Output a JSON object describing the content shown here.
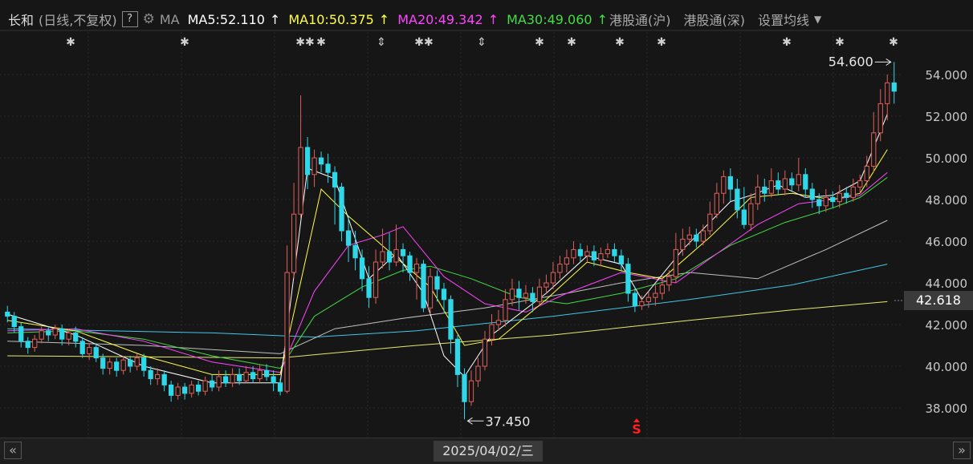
{
  "header": {
    "stock_name": "长和",
    "period": "(日线,不复权)",
    "help": "?",
    "ma_label": "MA",
    "ma5": "MA5:52.110",
    "ma10": "MA10:50.375",
    "ma20": "MA20:49.342",
    "ma30": "MA30:49.060",
    "arrow": "↑",
    "hk_connect_sh": "港股通(沪)",
    "hk_connect_sz": "港股通(深)",
    "settings": "设置均线"
  },
  "colors": {
    "up": "#e0605a",
    "down": "#2ed8e8",
    "ma5": "#ffffff",
    "ma10": "#ffff44",
    "ma20": "#ff44ff",
    "ma30": "#44dd44",
    "ma60": "#c0c0c0",
    "ma120": "#40c8e8",
    "ma250": "#e8e870"
  },
  "current_price_label": "42.618",
  "high_label": "54.600",
  "low_label": "37.450",
  "date_label": "2025/04/02/三",
  "nav": {
    "left": "«",
    "right": "»"
  },
  "event_markers": [
    "✱",
    "✱",
    "✱✱",
    "✱",
    "⇕",
    "✱✱",
    "⇕",
    "✱",
    "✱",
    "✱",
    "✱",
    "✱",
    "✱",
    "✱"
  ],
  "signal_marker": "S",
  "chart_data": {
    "type": "candlestick",
    "title": "长和",
    "y_ticks": [
      "54.000",
      "52.000",
      "50.000",
      "48.000",
      "46.000",
      "44.000",
      "42.000",
      "40.000",
      "38.000"
    ],
    "ylim": [
      37,
      55
    ],
    "max_price": 54.6,
    "min_price": 37.45,
    "current_price": 42.618,
    "candles": [
      [
        42.6,
        42.4,
        42.9,
        42.1
      ],
      [
        42.4,
        41.9,
        42.6,
        41.6
      ],
      [
        41.9,
        41.2,
        42.1,
        40.9
      ],
      [
        41.2,
        40.9,
        41.4,
        40.6
      ],
      [
        40.9,
        41.3,
        41.5,
        40.7
      ],
      [
        41.3,
        41.7,
        41.9,
        41.1
      ],
      [
        41.7,
        41.5,
        41.9,
        41.2
      ],
      [
        41.5,
        41.8,
        42.0,
        41.3
      ],
      [
        41.8,
        41.3,
        42.0,
        41.0
      ],
      [
        41.3,
        41.6,
        41.8,
        41.0
      ],
      [
        41.6,
        41.2,
        41.9,
        40.9
      ],
      [
        41.2,
        40.6,
        41.4,
        40.4
      ],
      [
        40.6,
        40.9,
        41.1,
        40.3
      ],
      [
        40.9,
        40.4,
        41.1,
        40.2
      ],
      [
        40.4,
        39.9,
        40.6,
        39.6
      ],
      [
        39.9,
        40.2,
        40.4,
        39.6
      ],
      [
        40.2,
        39.8,
        40.4,
        39.5
      ],
      [
        39.8,
        40.3,
        40.5,
        39.6
      ],
      [
        40.3,
        40.0,
        40.5,
        39.7
      ],
      [
        40.0,
        40.4,
        40.6,
        39.8
      ],
      [
        40.4,
        39.8,
        40.6,
        39.5
      ],
      [
        39.8,
        39.4,
        40.0,
        39.1
      ],
      [
        39.4,
        39.6,
        39.9,
        39.1
      ],
      [
        39.6,
        39.1,
        39.8,
        38.8
      ],
      [
        39.1,
        38.6,
        39.3,
        38.3
      ],
      [
        38.6,
        39.0,
        39.2,
        38.4
      ],
      [
        39.0,
        38.7,
        39.2,
        38.4
      ],
      [
        38.7,
        39.1,
        39.3,
        38.5
      ],
      [
        39.1,
        38.8,
        39.3,
        38.6
      ],
      [
        38.8,
        39.3,
        39.5,
        38.6
      ],
      [
        39.3,
        39.0,
        39.6,
        38.8
      ],
      [
        39.0,
        39.5,
        39.8,
        38.8
      ],
      [
        39.5,
        39.2,
        39.8,
        39.0
      ],
      [
        39.2,
        39.6,
        39.9,
        39.0
      ],
      [
        39.6,
        39.3,
        39.9,
        39.1
      ],
      [
        39.3,
        39.7,
        40.0,
        39.2
      ],
      [
        39.7,
        39.4,
        40.0,
        39.2
      ],
      [
        39.4,
        39.8,
        40.1,
        39.2
      ],
      [
        39.8,
        39.5,
        40.1,
        39.3
      ],
      [
        39.5,
        39.2,
        39.8,
        38.8
      ],
      [
        39.2,
        38.8,
        39.4,
        38.6
      ],
      [
        38.8,
        44.5,
        45.8,
        38.7
      ],
      [
        44.5,
        47.3,
        48.8,
        44.2
      ],
      [
        47.3,
        50.5,
        53.0,
        47.1
      ],
      [
        50.5,
        49.2,
        51.0,
        48.5
      ],
      [
        49.2,
        50.0,
        50.4,
        48.6
      ],
      [
        50.0,
        49.7,
        50.3,
        49.3
      ],
      [
        49.7,
        49.3,
        50.2,
        48.8
      ],
      [
        49.3,
        48.6,
        49.6,
        46.8
      ],
      [
        48.6,
        46.5,
        48.8,
        46.0
      ],
      [
        46.5,
        45.8,
        47.2,
        45.0
      ],
      [
        45.8,
        45.2,
        46.5,
        44.6
      ],
      [
        45.2,
        44.2,
        45.6,
        43.6
      ],
      [
        44.2,
        43.3,
        44.8,
        42.8
      ],
      [
        43.3,
        45.0,
        45.6,
        43.0
      ],
      [
        45.0,
        45.5,
        46.6,
        44.7
      ],
      [
        45.5,
        45.0,
        46.4,
        44.6
      ],
      [
        45.0,
        45.6,
        46.8,
        44.8
      ],
      [
        45.6,
        45.3,
        45.9,
        44.5
      ],
      [
        45.3,
        44.5,
        45.5,
        44.1
      ],
      [
        44.5,
        44.9,
        45.2,
        43.2
      ],
      [
        44.9,
        42.8,
        45.1,
        42.6
      ],
      [
        42.8,
        44.3,
        44.7,
        42.5
      ],
      [
        44.3,
        43.7,
        44.6,
        43.1
      ],
      [
        43.7,
        43.2,
        44.0,
        42.6
      ],
      [
        43.2,
        41.3,
        43.4,
        40.6
      ],
      [
        41.3,
        39.6,
        41.5,
        39.0
      ],
      [
        39.6,
        38.3,
        39.9,
        37.45
      ],
      [
        38.3,
        39.3,
        39.8,
        38.1
      ],
      [
        39.3,
        40.0,
        40.4,
        39.0
      ],
      [
        40.0,
        41.3,
        41.7,
        39.8
      ],
      [
        41.3,
        42.0,
        42.5,
        41.0
      ],
      [
        42.0,
        42.2,
        42.7,
        41.7
      ],
      [
        42.2,
        43.2,
        43.7,
        41.9
      ],
      [
        43.2,
        43.7,
        44.2,
        42.9
      ],
      [
        43.7,
        43.3,
        44.1,
        42.7
      ],
      [
        43.3,
        43.5,
        43.9,
        43.0
      ],
      [
        43.5,
        43.1,
        43.8,
        42.6
      ],
      [
        43.1,
        43.8,
        44.2,
        42.9
      ],
      [
        43.8,
        44.0,
        44.4,
        43.5
      ],
      [
        44.0,
        44.5,
        45.0,
        43.7
      ],
      [
        44.5,
        44.9,
        45.3,
        44.2
      ],
      [
        44.9,
        45.2,
        45.6,
        44.5
      ],
      [
        45.2,
        45.6,
        46.0,
        44.9
      ],
      [
        45.6,
        45.3,
        45.9,
        45.0
      ],
      [
        45.3,
        45.5,
        45.8,
        45.0
      ],
      [
        45.5,
        45.1,
        45.8,
        44.8
      ],
      [
        45.1,
        45.4,
        45.7,
        44.8
      ],
      [
        45.4,
        45.6,
        45.9,
        45.2
      ],
      [
        45.6,
        45.3,
        45.9,
        45.0
      ],
      [
        45.3,
        44.9,
        45.6,
        44.6
      ],
      [
        44.9,
        43.5,
        45.2,
        43.1
      ],
      [
        43.5,
        42.9,
        43.8,
        42.6
      ],
      [
        42.9,
        43.1,
        43.4,
        42.7
      ],
      [
        43.1,
        43.3,
        43.6,
        42.8
      ],
      [
        43.3,
        43.5,
        43.9,
        42.9
      ],
      [
        43.5,
        43.9,
        44.3,
        43.2
      ],
      [
        43.9,
        44.3,
        44.6,
        43.6
      ],
      [
        44.3,
        45.6,
        46.4,
        44.0
      ],
      [
        45.6,
        46.1,
        46.6,
        45.3
      ],
      [
        46.1,
        46.3,
        46.7,
        45.8
      ],
      [
        46.3,
        46.0,
        46.6,
        45.7
      ],
      [
        46.0,
        46.5,
        46.8,
        45.8
      ],
      [
        46.5,
        47.3,
        47.9,
        46.3
      ],
      [
        47.3,
        48.3,
        48.8,
        47.1
      ],
      [
        48.3,
        49.1,
        49.4,
        47.8
      ],
      [
        49.1,
        48.5,
        49.5,
        47.9
      ],
      [
        48.5,
        47.5,
        49.0,
        47.1
      ],
      [
        47.5,
        46.8,
        48.6,
        46.6
      ],
      [
        46.8,
        47.8,
        48.3,
        46.5
      ],
      [
        47.8,
        48.6,
        49.2,
        47.5
      ],
      [
        48.6,
        48.3,
        49.0,
        47.9
      ],
      [
        48.3,
        48.9,
        49.5,
        48.1
      ],
      [
        48.9,
        48.5,
        49.3,
        48.2
      ],
      [
        48.5,
        49.0,
        49.4,
        48.2
      ],
      [
        49.0,
        48.7,
        49.3,
        48.4
      ],
      [
        48.7,
        49.2,
        50.0,
        48.4
      ],
      [
        49.2,
        48.5,
        49.5,
        48.1
      ],
      [
        48.5,
        48.0,
        48.8,
        47.6
      ],
      [
        48.0,
        47.7,
        48.3,
        47.3
      ],
      [
        47.7,
        48.1,
        48.5,
        47.4
      ],
      [
        48.1,
        47.9,
        48.4,
        47.6
      ],
      [
        47.9,
        48.3,
        48.7,
        47.6
      ],
      [
        48.3,
        48.1,
        48.6,
        47.8
      ],
      [
        48.1,
        48.6,
        49.0,
        47.9
      ],
      [
        48.6,
        48.9,
        49.2,
        48.3
      ],
      [
        48.9,
        49.6,
        50.1,
        48.6
      ],
      [
        49.6,
        51.2,
        52.2,
        49.3
      ],
      [
        51.2,
        52.6,
        53.3,
        50.8
      ],
      [
        52.6,
        53.6,
        54.0,
        51.8
      ],
      [
        53.6,
        53.2,
        54.6,
        52.6
      ]
    ],
    "ma_lines": {
      "ma5": [
        [
          0,
          42.5
        ],
        [
          10,
          41.5
        ],
        [
          20,
          40.0
        ],
        [
          30,
          39.2
        ],
        [
          40,
          39.2
        ],
        [
          44,
          49.5
        ],
        [
          48,
          49.0
        ],
        [
          53,
          44.2
        ],
        [
          57,
          45.4
        ],
        [
          61,
          43.5
        ],
        [
          64,
          40.5
        ],
        [
          67,
          39.5
        ],
        [
          71,
          41.5
        ],
        [
          79,
          43.5
        ],
        [
          85,
          45.3
        ],
        [
          90,
          44.9
        ],
        [
          93,
          43.2
        ],
        [
          99,
          45.6
        ],
        [
          106,
          47.9
        ],
        [
          109,
          48.2
        ],
        [
          113,
          48.7
        ],
        [
          117,
          48.1
        ],
        [
          121,
          48.2
        ],
        [
          125,
          48.9
        ],
        [
          129,
          52.1
        ]
      ],
      "ma10": [
        [
          0,
          42.2
        ],
        [
          10,
          41.7
        ],
        [
          20,
          40.5
        ],
        [
          30,
          39.6
        ],
        [
          40,
          39.6
        ],
        [
          46,
          48.5
        ],
        [
          50,
          47.2
        ],
        [
          56,
          45.5
        ],
        [
          62,
          43.8
        ],
        [
          67,
          41.0
        ],
        [
          72,
          41.3
        ],
        [
          79,
          43.2
        ],
        [
          85,
          45.0
        ],
        [
          91,
          44.5
        ],
        [
          96,
          44.2
        ],
        [
          103,
          46.2
        ],
        [
          109,
          48.1
        ],
        [
          115,
          48.3
        ],
        [
          121,
          48.0
        ],
        [
          125,
          48.3
        ],
        [
          129,
          50.4
        ]
      ],
      "ma20": [
        [
          0,
          41.7
        ],
        [
          10,
          41.8
        ],
        [
          20,
          41.2
        ],
        [
          30,
          40.2
        ],
        [
          40,
          39.7
        ],
        [
          45,
          43.6
        ],
        [
          50,
          45.8
        ],
        [
          55,
          46.3
        ],
        [
          58,
          46.7
        ],
        [
          64,
          44.3
        ],
        [
          70,
          43.0
        ],
        [
          76,
          42.6
        ],
        [
          82,
          43.5
        ],
        [
          90,
          44.5
        ],
        [
          98,
          44.0
        ],
        [
          104,
          45.4
        ],
        [
          110,
          46.8
        ],
        [
          116,
          47.8
        ],
        [
          121,
          48.0
        ],
        [
          125,
          48.2
        ],
        [
          129,
          49.3
        ]
      ],
      "ma30": [
        [
          0,
          41.6
        ],
        [
          10,
          41.7
        ],
        [
          20,
          41.3
        ],
        [
          30,
          40.5
        ],
        [
          40,
          39.9
        ],
        [
          45,
          42.4
        ],
        [
          52,
          43.8
        ],
        [
          58,
          44.6
        ],
        [
          62,
          44.8
        ],
        [
          68,
          44.2
        ],
        [
          75,
          43.3
        ],
        [
          82,
          43.0
        ],
        [
          90,
          43.5
        ],
        [
          98,
          44.2
        ],
        [
          106,
          45.8
        ],
        [
          114,
          46.9
        ],
        [
          121,
          47.6
        ],
        [
          125,
          48.1
        ],
        [
          129,
          49.06
        ]
      ],
      "ma60": [
        [
          0,
          41.2
        ],
        [
          20,
          41.0
        ],
        [
          40,
          40.6
        ],
        [
          48,
          41.8
        ],
        [
          58,
          42.3
        ],
        [
          70,
          42.8
        ],
        [
          82,
          43.5
        ],
        [
          90,
          44.0
        ],
        [
          100,
          44.5
        ],
        [
          110,
          44.2
        ],
        [
          120,
          45.6
        ],
        [
          129,
          47.0
        ]
      ],
      "ma120": [
        [
          0,
          41.8
        ],
        [
          30,
          41.6
        ],
        [
          45,
          41.4
        ],
        [
          60,
          41.7
        ],
        [
          80,
          42.4
        ],
        [
          100,
          43.2
        ],
        [
          115,
          43.9
        ],
        [
          129,
          44.9
        ]
      ],
      "ma250": [
        [
          0,
          40.5
        ],
        [
          40,
          40.4
        ],
        [
          60,
          41.0
        ],
        [
          80,
          41.5
        ],
        [
          100,
          42.2
        ],
        [
          115,
          42.7
        ],
        [
          129,
          43.1
        ]
      ]
    }
  }
}
